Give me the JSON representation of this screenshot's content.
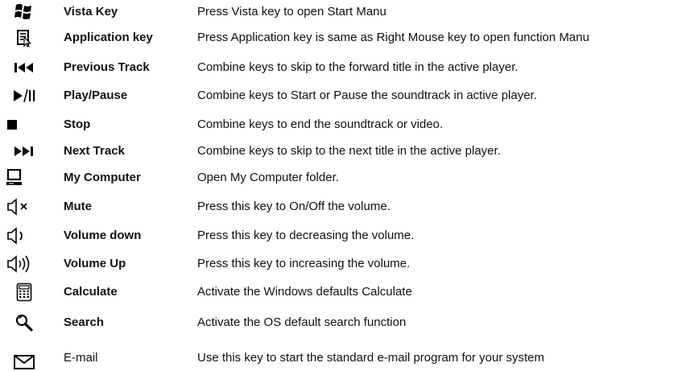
{
  "keys": [
    {
      "icon": "windows-logo-icon",
      "name": "Vista Key",
      "description": "Press Vista key to open Start Manu",
      "bold": true
    },
    {
      "icon": "application-menu-icon",
      "name": "Application key",
      "description": "Press Application key is same as Right Mouse key to open function Manu",
      "bold": true
    },
    {
      "icon": "previous-track-icon",
      "name": "Previous Track",
      "description": "Combine keys to skip to the forward title in the active player.",
      "bold": true
    },
    {
      "icon": "play-pause-icon",
      "name": "Play/Pause",
      "description": "Combine keys to Start or Pause the soundtrack in active player.",
      "bold": true
    },
    {
      "icon": "stop-icon",
      "name": "Stop",
      "description": "Combine keys to end the soundtrack or video.",
      "bold": true
    },
    {
      "icon": "next-track-icon",
      "name": "Next Track",
      "description": "Combine keys to skip to the next title in the active player.",
      "bold": true
    },
    {
      "icon": "computer-icon",
      "name": "My Computer",
      "description": "Open My Computer folder.",
      "bold": true
    },
    {
      "icon": "mute-icon",
      "name": "Mute",
      "description": "Press this key to On/Off the volume.",
      "bold": true
    },
    {
      "icon": "volume-down-icon",
      "name": "Volume down",
      "description": "Press this key to decreasing the volume.",
      "bold": true
    },
    {
      "icon": "volume-up-icon",
      "name": "Volume Up",
      "description": "Press this key to increasing the volume.",
      "bold": true
    },
    {
      "icon": "calculator-icon",
      "name": "Calculate",
      "description": "Activate the Windows defaults Calculate",
      "bold": true
    },
    {
      "icon": "search-magnifier-icon",
      "name": "Search",
      "description": "Activate the OS default search function",
      "bold": true
    },
    {
      "icon": "email-envelope-icon",
      "name": "E-mail",
      "description": "Use this key to start the standard e-mail program for your system",
      "bold": false
    }
  ]
}
